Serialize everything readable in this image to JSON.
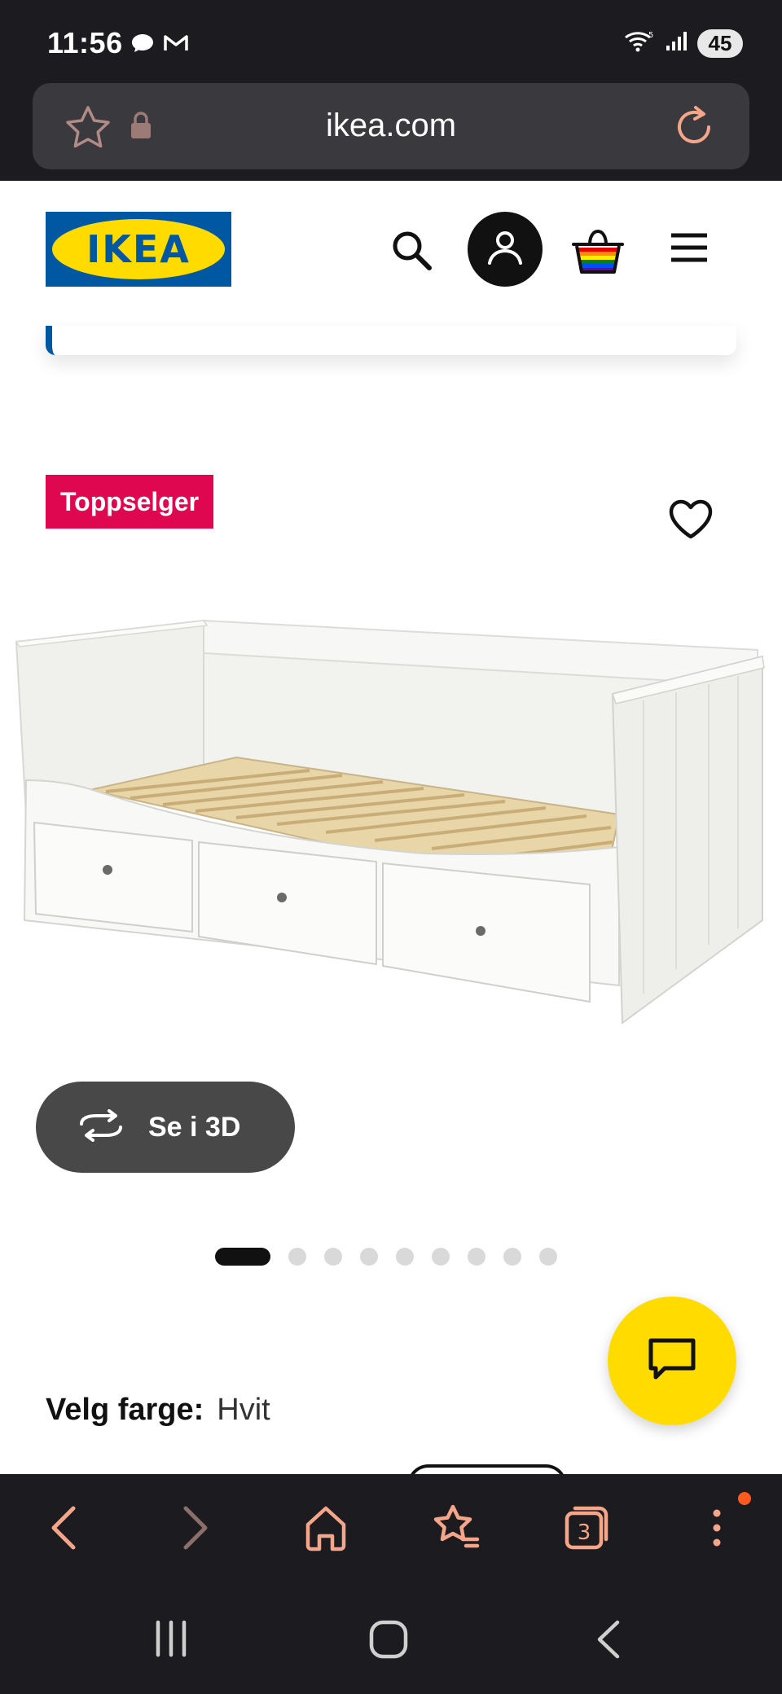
{
  "status_bar": {
    "time": "11:56",
    "left_icons": [
      "chat-bubble-icon",
      "gmail-icon"
    ],
    "right_icons": [
      "wifi-icon",
      "signal-icon"
    ],
    "battery": "45"
  },
  "browser": {
    "url": "ikea.com",
    "bookmark_icon": "star-icon",
    "lock_icon": "lock-icon",
    "reload_icon": "reload-icon",
    "toolbar": {
      "tab_count": "3",
      "icons": [
        "back-icon",
        "forward-icon",
        "home-icon",
        "bookmarks-icon",
        "tabs-icon",
        "more-icon"
      ]
    }
  },
  "header": {
    "logo_text": "IKEA",
    "icons": [
      "search-icon",
      "account-icon",
      "basket-icon",
      "menu-icon"
    ]
  },
  "product": {
    "badge": "Toppselger",
    "favorite_icon": "heart-icon",
    "view_3d_label": "Se i 3D",
    "carousel": {
      "total": 10,
      "active": 0
    },
    "color_label": "Velg farge:",
    "color_value": "Hvit"
  },
  "colors": {
    "accent_blue": "#0058a3",
    "accent_yellow": "#ffdb00",
    "badge_red": "#e00751",
    "browser_icon": "#f4a58a"
  }
}
